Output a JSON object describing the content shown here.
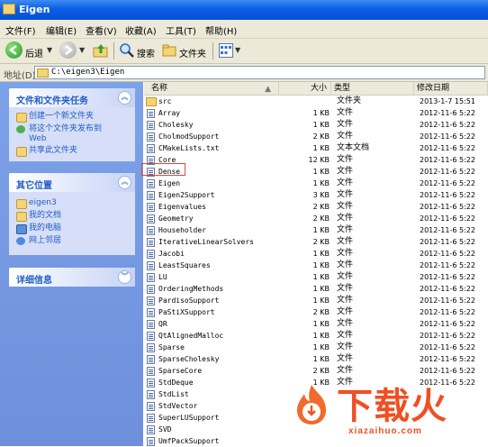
{
  "window": {
    "title": "Eigen"
  },
  "menu": [
    "文件(F)",
    "编辑(E)",
    "查看(V)",
    "收藏(A)",
    "工具(T)",
    "帮助(H)"
  ],
  "toolbar": {
    "back": "后退",
    "search": "搜索",
    "folders": "文件夹"
  },
  "address": {
    "label": "地址(D)",
    "path": "C:\\eigen3\\Eigen"
  },
  "left": {
    "tasks": {
      "title": "文件和文件夹任务",
      "items": [
        "创建一个新文件夹",
        "将这个文件夹发布到",
        "Web",
        "共享此文件夹"
      ]
    },
    "places": {
      "title": "其它位置",
      "items": [
        "eigen3",
        "我的文档",
        "我的电脑",
        "网上邻居"
      ]
    },
    "details": {
      "title": "详细信息"
    }
  },
  "columns": {
    "name": "名称",
    "size": "大小",
    "type": "类型",
    "date": "修改日期"
  },
  "files": [
    {
      "name": "src",
      "size": "",
      "type": "文件夹",
      "date": "2013-1-7 15:51",
      "folder": true
    },
    {
      "name": "Array",
      "size": "1 KB",
      "type": "文件",
      "date": "2012-11-6 5:22"
    },
    {
      "name": "Cholesky",
      "size": "1 KB",
      "type": "文件",
      "date": "2012-11-6 5:22"
    },
    {
      "name": "CholmodSupport",
      "size": "2 KB",
      "type": "文件",
      "date": "2012-11-6 5:22"
    },
    {
      "name": "CMakeLists.txt",
      "size": "1 KB",
      "type": "文本文档",
      "date": "2012-11-6 5:22"
    },
    {
      "name": "Core",
      "size": "12 KB",
      "type": "文件",
      "date": "2012-11-6 5:22"
    },
    {
      "name": "Dense",
      "size": "1 KB",
      "type": "文件",
      "date": "2012-11-6 5:22"
    },
    {
      "name": "Eigen",
      "size": "1 KB",
      "type": "文件",
      "date": "2012-11-6 5:22"
    },
    {
      "name": "Eigen2Support",
      "size": "3 KB",
      "type": "文件",
      "date": "2012-11-6 5:22"
    },
    {
      "name": "Eigenvalues",
      "size": "2 KB",
      "type": "文件",
      "date": "2012-11-6 5:22"
    },
    {
      "name": "Geometry",
      "size": "2 KB",
      "type": "文件",
      "date": "2012-11-6 5:22"
    },
    {
      "name": "Householder",
      "size": "1 KB",
      "type": "文件",
      "date": "2012-11-6 5:22"
    },
    {
      "name": "IterativeLinearSolvers",
      "size": "2 KB",
      "type": "文件",
      "date": "2012-11-6 5:22"
    },
    {
      "name": "Jacobi",
      "size": "1 KB",
      "type": "文件",
      "date": "2012-11-6 5:22"
    },
    {
      "name": "LeastSquares",
      "size": "1 KB",
      "type": "文件",
      "date": "2012-11-6 5:22"
    },
    {
      "name": "LU",
      "size": "1 KB",
      "type": "文件",
      "date": "2012-11-6 5:22"
    },
    {
      "name": "OrderingMethods",
      "size": "1 KB",
      "type": "文件",
      "date": "2012-11-6 5:22"
    },
    {
      "name": "PardisoSupport",
      "size": "1 KB",
      "type": "文件",
      "date": "2012-11-6 5:22"
    },
    {
      "name": "PaStiXSupport",
      "size": "2 KB",
      "type": "文件",
      "date": "2012-11-6 5:22"
    },
    {
      "name": "QR",
      "size": "1 KB",
      "type": "文件",
      "date": "2012-11-6 5:22"
    },
    {
      "name": "QtAlignedMalloc",
      "size": "1 KB",
      "type": "文件",
      "date": "2012-11-6 5:22"
    },
    {
      "name": "Sparse",
      "size": "1 KB",
      "type": "文件",
      "date": "2012-11-6 5:22"
    },
    {
      "name": "SparseCholesky",
      "size": "1 KB",
      "type": "文件",
      "date": "2012-11-6 5:22"
    },
    {
      "name": "SparseCore",
      "size": "2 KB",
      "type": "文件",
      "date": "2012-11-6 5:22"
    },
    {
      "name": "StdDeque",
      "size": "1 KB",
      "type": "文件",
      "date": "2012-11-6 5:22"
    },
    {
      "name": "StdList",
      "size": "",
      "type": "",
      "date": ""
    },
    {
      "name": "StdVector",
      "size": "",
      "type": "",
      "date": ""
    },
    {
      "name": "SuperLUSupport",
      "size": "",
      "type": "",
      "date": ""
    },
    {
      "name": "SVD",
      "size": "",
      "type": "",
      "date": ""
    },
    {
      "name": "UmfPackSupport",
      "size": "",
      "type": "",
      "date": ""
    }
  ],
  "watermark": {
    "cn": "下载火",
    "url": "xiazaihuo.com"
  }
}
